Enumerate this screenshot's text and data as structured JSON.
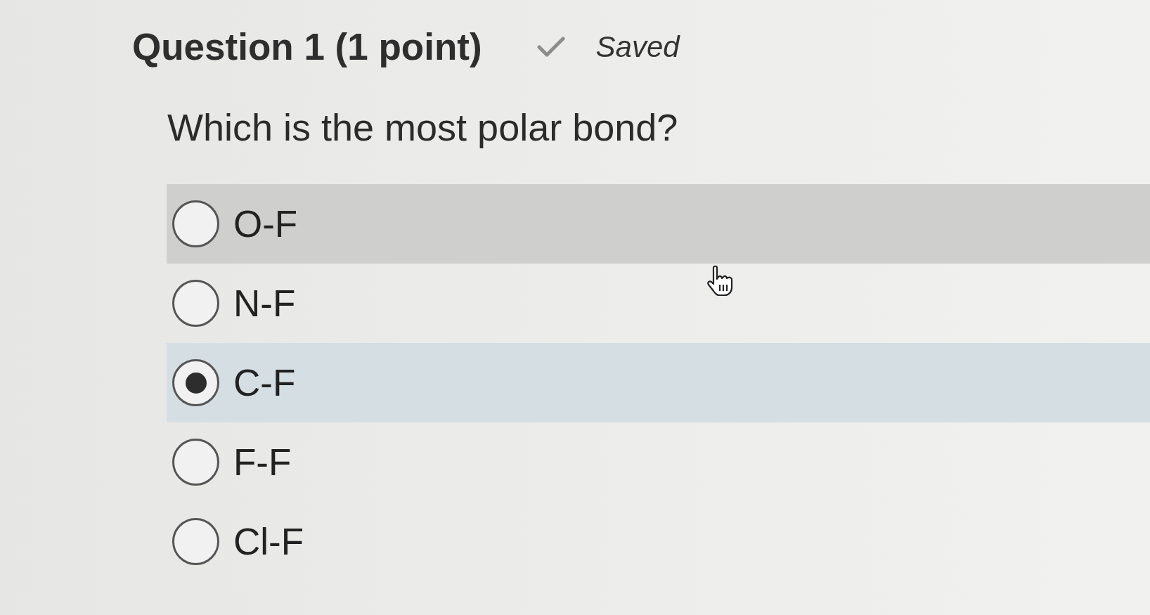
{
  "question": {
    "title": "Question 1 (1 point)",
    "status": "Saved",
    "prompt": "Which is the most polar bond?",
    "options": [
      {
        "label": "O-F",
        "selected": false,
        "hovered": true
      },
      {
        "label": "N-F",
        "selected": false,
        "hovered": false
      },
      {
        "label": "C-F",
        "selected": true,
        "hovered": false
      },
      {
        "label": "F-F",
        "selected": false,
        "hovered": false
      },
      {
        "label": "Cl-F",
        "selected": false,
        "hovered": false
      }
    ]
  }
}
